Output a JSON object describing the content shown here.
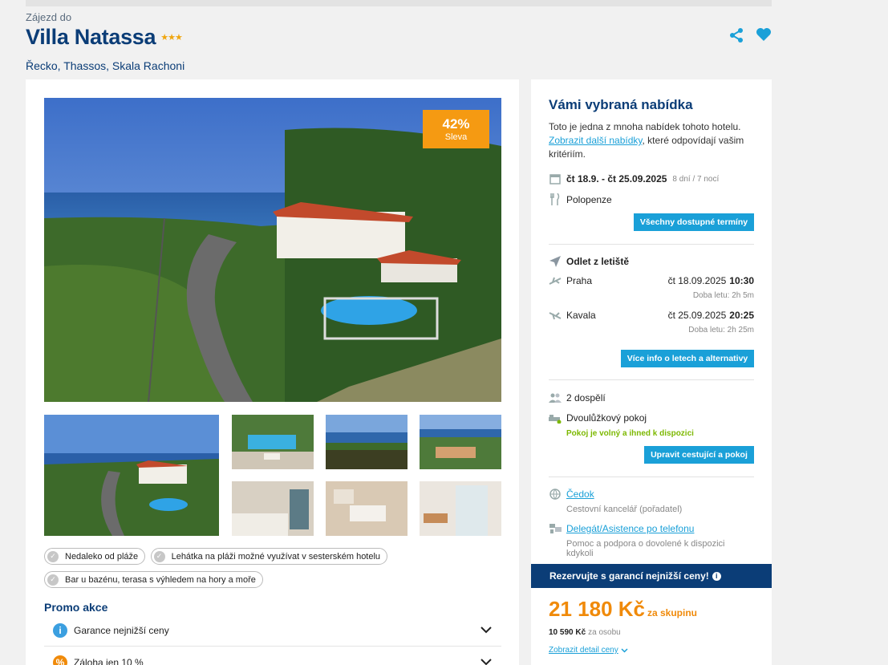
{
  "header": {
    "eyebrow": "Zájezd do",
    "title": "Villa Natassa",
    "stars": "★★★",
    "location": "Řecko, Thassos, Skala Rachoni"
  },
  "colors": {
    "brand": "#0b3d77",
    "accent": "#1aa0d8",
    "badge": "#f59a12",
    "price": "#f08a0a",
    "available": "#7cb800"
  },
  "hero": {
    "discount": "42%",
    "discount_label": "Sleva"
  },
  "features": [
    "Nedaleko od pláže",
    "Lehátka na pláži možné využívat v sesterském hotelu",
    "Bar u bazénu, terasa s výhledem na hory a moře"
  ],
  "promo": {
    "title": "Promo akce",
    "items": [
      {
        "label": "Garance nejnižší ceny",
        "icon": "info-icon"
      },
      {
        "label": "Záloha jen 10 %",
        "icon": "percent-icon"
      }
    ]
  },
  "offer": {
    "title": "Vámi vybraná nabídka",
    "text_before": "Toto je jedna z mnoha nabídek tohoto hotelu.",
    "text_link": "Zobrazit další nabídky",
    "text_after": ", které odpovídají vašim kritériím.",
    "dates": "čt 18.9. - čt 25.09.2025",
    "duration": "8 dní / 7 nocí",
    "board": "Polopenze",
    "terms_button": "Všechny dostupné termíny",
    "departure_label": "Odlet z letiště",
    "outbound": {
      "city": "Praha",
      "date": "čt 18.09.2025",
      "time": "10:30",
      "duration": "Doba letu: 2h 5m"
    },
    "inbound": {
      "city": "Kavala",
      "date": "čt 25.09.2025",
      "time": "20:25",
      "duration": "Doba letu: 2h 25m"
    },
    "flights_button": "Více info o letech a alternativy",
    "travelers": "2 dospělí",
    "room": "Dvoulůžkový pokoj",
    "room_status": "Pokoj je volný a ihned k dispozici",
    "edit_button": "Upravit cestující a pokoj",
    "agency_link": "Čedok",
    "agency_sub": "Cestovní kancelář (pořadatel)",
    "support_link": "Delegát/Asistence po telefonu",
    "support_sub": "Pomoc a podpora o dovolené k dispozici kdykoli",
    "guarantee": "Rezervujte s garancí nejnižší ceny!",
    "price": "21 180 Kč",
    "price_suffix": "za skupinu",
    "per_person": "10 590 Kč",
    "per_person_suffix": "za osobu",
    "detail_link": "Zobrazit detail ceny"
  }
}
